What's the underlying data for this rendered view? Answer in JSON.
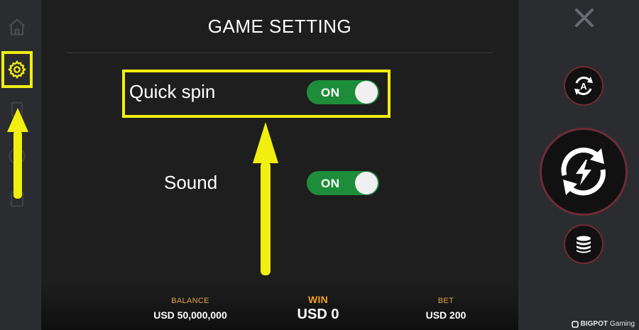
{
  "panel": {
    "title": "GAME SETTING"
  },
  "settings": [
    {
      "label": "Quick spin",
      "state": "ON"
    },
    {
      "label": "Sound",
      "state": "ON"
    }
  ],
  "footer": {
    "balance_label": "BALANCE",
    "balance_value": "USD 50,000,000",
    "win_label": "WIN",
    "win_value": "USD 0",
    "bet_label": "BET",
    "bet_value": "USD 200"
  },
  "brand": {
    "name": "BIGPOT",
    "suffix": "Gaming"
  },
  "icons": {
    "home": "home-icon",
    "settings": "gear-icon",
    "close": "close-icon",
    "auto": "autoplay-icon",
    "spin": "spin-icon",
    "coins": "coins-icon"
  },
  "colors": {
    "highlight": "#f1ef10",
    "toggle_on": "#1e8d3a",
    "accent_label": "#e3a245"
  }
}
